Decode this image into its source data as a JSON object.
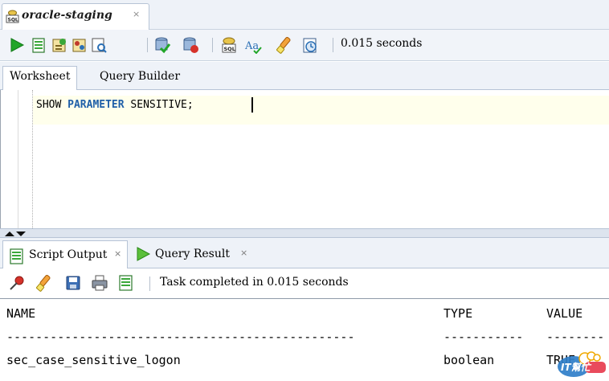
{
  "doc_tab": {
    "title": "oracle-staging",
    "close": "×",
    "icon": "sql-file-icon"
  },
  "toolbar": {
    "icons": [
      "run-statement-icon",
      "run-script-icon",
      "autotrace-icon",
      "explain-plan-icon",
      "sql-tuning-icon",
      "commit-icon",
      "rollback-icon",
      "unshared-sql-icon",
      "to-upper-lower-icon",
      "clear-icon",
      "sql-history-icon"
    ],
    "timing": "0.015 seconds"
  },
  "worksheet_tabs": {
    "worksheet": "Worksheet",
    "query_builder": "Query Builder"
  },
  "editor": {
    "keyword1": "SHOW",
    "keyword2": "PARAMETER",
    "argument": "SENSITIVE;"
  },
  "output_tabs": {
    "script_output": "Script Output",
    "query_result": "Query Result",
    "close": "×"
  },
  "output_toolbar": {
    "icons": [
      "pin-icon",
      "clear-icon",
      "save-icon",
      "print-icon",
      "script-output-icon"
    ],
    "message": "Task completed in 0.015 seconds"
  },
  "output": {
    "headers": {
      "name": "NAME",
      "type": "TYPE",
      "value": "VALUE"
    },
    "sep_name": "------------------------------------------------",
    "sep_type": "-----------",
    "sep_value": "--------",
    "rows": [
      {
        "name": "sec_case_sensitive_logon",
        "type": "boolean",
        "value": "TRUE"
      }
    ]
  },
  "watermark": {
    "text": "IT幫忙"
  },
  "colors": {
    "keyword": "#1f5fa8",
    "current_line": "#ffffec",
    "run_green": "#22a629"
  }
}
